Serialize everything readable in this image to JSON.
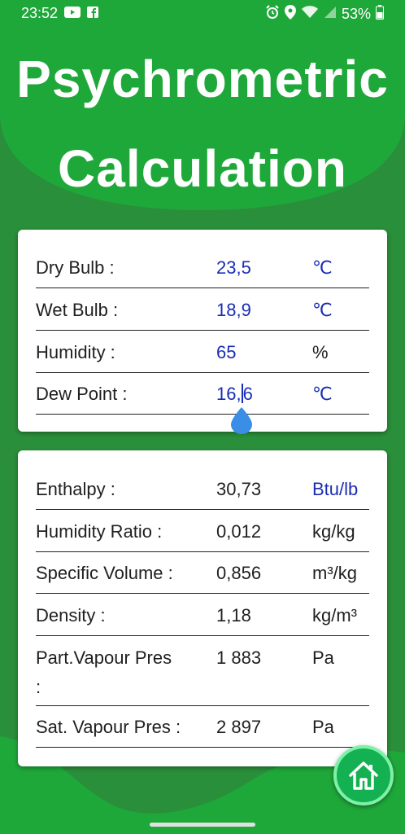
{
  "status_bar": {
    "time": "23:52",
    "battery": "53%",
    "left_icons": [
      "youtube-icon",
      "facebook-icon"
    ],
    "right_icons": [
      "alarm-icon",
      "location-icon",
      "wifi-icon",
      "signal-icon",
      "battery-icon"
    ]
  },
  "header": {
    "title_line1": "Psychrometric",
    "title_line2": "Calculation"
  },
  "inputs": {
    "dry_bulb": {
      "label": "Dry Bulb :",
      "value": "23,5",
      "unit": "℃"
    },
    "wet_bulb": {
      "label": "Wet Bulb :",
      "value": "18,9",
      "unit": "℃"
    },
    "humidity": {
      "label": "Humidity :",
      "value": "65",
      "unit": "%"
    },
    "dew_point": {
      "label": "Dew Point :",
      "value": "16,6",
      "value_part1": "16,",
      "value_part2": "6",
      "unit": "℃"
    }
  },
  "results": {
    "enthalpy": {
      "label": "Enthalpy :",
      "value": "30,73",
      "unit": "Btu/lb"
    },
    "humidity_ratio": {
      "label": "Humidity Ratio :",
      "value": "0,012",
      "unit": "kg/kg"
    },
    "specific_volume": {
      "label": "Specific Volume :",
      "value": "0,856",
      "unit": "m³/kg"
    },
    "density": {
      "label": "Density :",
      "value": "1,18",
      "unit": "kg/m³"
    },
    "part_vapour_pres": {
      "label_line1": "Part.Vapour Pres",
      "label_line2": ":",
      "value": "1 883",
      "unit": "Pa"
    },
    "sat_vapour_pres": {
      "label": "Sat. Vapour Pres :",
      "value": "2 897",
      "unit": "Pa"
    }
  },
  "colors": {
    "background": "#2a8f3a",
    "header": "#1fa83a",
    "accent_blue": "#1a2db5",
    "home_button": "#14b152"
  }
}
